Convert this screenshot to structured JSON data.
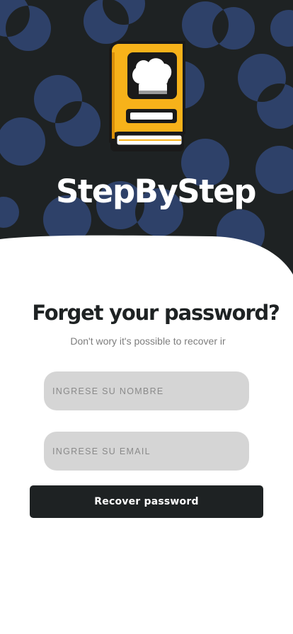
{
  "app": {
    "name": "StepByStep",
    "logo_icon": "chef-hat-recipe-book-icon"
  },
  "recovery": {
    "title": "Forget your password?",
    "subtitle": "Don't wory it's possible to recover ir",
    "name_placeholder": "INGRESE SU NOMBRE",
    "name_value": "",
    "email_placeholder": "INGRESE SU EMAIL",
    "email_value": "",
    "submit_label": "Recover password"
  },
  "colors": {
    "dark_background": "#1e2223",
    "pattern_blue": "#2e4169",
    "book_orange": "#f7b21a",
    "input_background": "#d5d5d5",
    "button_background": "#1e2223",
    "subtitle_text": "#7d7d7d"
  }
}
